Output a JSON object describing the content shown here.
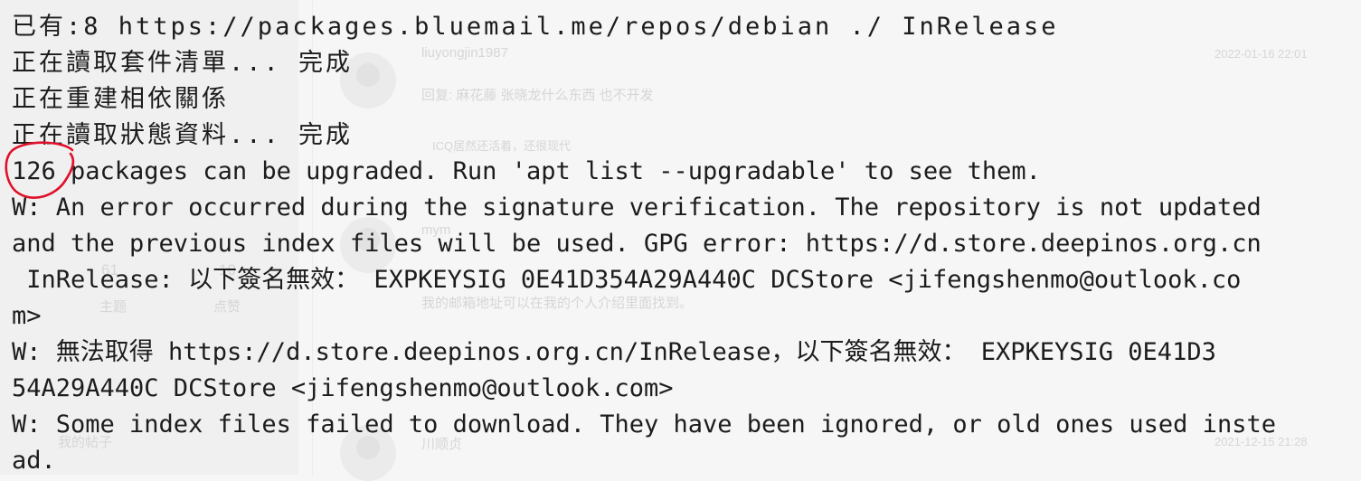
{
  "background_page": {
    "comments": [
      {
        "user": "liuyongjin1987",
        "time": "2022-01-16 22:01",
        "reply_prefix": "回复:",
        "reply_text": "麻花藤 张晓龙什么东西 也不开发"
      },
      {
        "text": "ICQ居然还活着，还很现代"
      },
      {
        "user": "mym",
        "body": "我的邮箱地址可以在我的个人介绍里面找到。"
      },
      {
        "user": "川顺贞",
        "time": "2021-12-15 21:28"
      }
    ],
    "sidebar": {
      "stat_topics_value": "61",
      "stat_topics_label": "主题",
      "stat_likes_value": "10",
      "stat_likes_label": "点赞",
      "my_posts": "我的帖子"
    }
  },
  "terminal": {
    "lines": [
      "已有:8 https://packages.bluemail.me/repos/debian ./ InRelease",
      "正在讀取套件清單... 完成",
      "正在重建相依關係",
      "正在讀取狀態資料... 完成",
      "126 packages can be upgraded. Run 'apt list --upgradable' to see them.",
      "W: An error occurred during the signature verification. The repository is not updated",
      "and the previous index files will be used. GPG error: https://d.store.deepinos.org.cn",
      " InRelease: 以下簽名無效： EXPKEYSIG 0E41D354A29A440C DCStore <jifengshenmo@outlook.co",
      "m>",
      "W: 無法取得 https://d.store.deepinos.org.cn/InRelease，以下簽名無效： EXPKEYSIG 0E41D3",
      "54A29A440C DCStore <jifengshenmo@outlook.com>",
      "W: Some index files failed to download. They have been ignored, or old ones used inste",
      "ad."
    ]
  },
  "annotation": {
    "color": "#e0102a",
    "icon": "red-circle-annotation"
  }
}
